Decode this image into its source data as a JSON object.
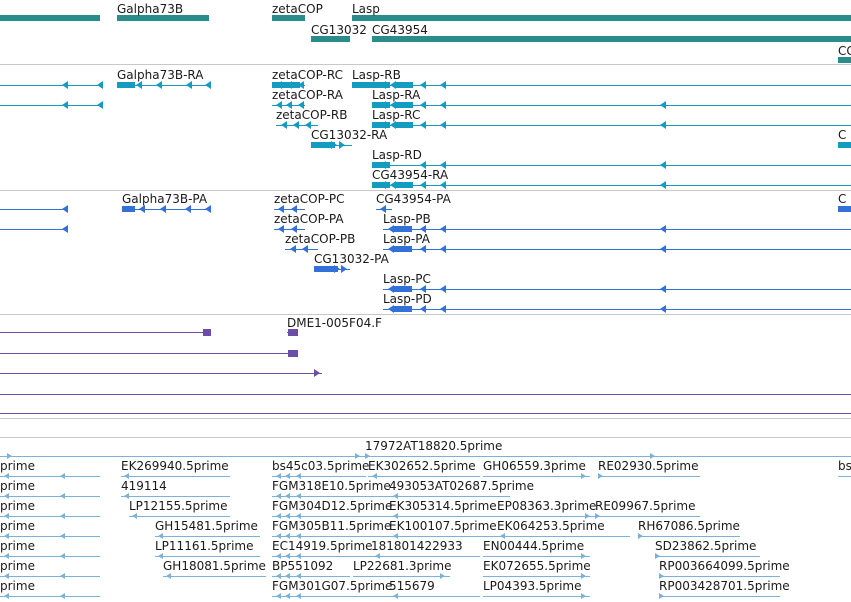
{
  "colors": {
    "gene": "#2b8c8c",
    "transcript": "#139bc0",
    "protein": "#3370d8",
    "clone": "#6c4da8",
    "est": "#7bb2d9",
    "divider": "#c8c8c8",
    "text": "#1a1a1a"
  },
  "tracks": [
    {
      "name": "gene-track",
      "color": "gene",
      "features": [
        {
          "name": "",
          "strand": "+",
          "boxes": [
            [
              0,
              100
            ]
          ]
        },
        {
          "name": "Galpha73B",
          "label": "Galpha73B",
          "strand": "-",
          "boxes": [
            [
              117,
              209
            ]
          ]
        },
        {
          "name": "zetaCOP",
          "label": "zetaCOP",
          "strand": "-",
          "boxes": [
            [
              272,
              305
            ]
          ]
        },
        {
          "name": "Lasp",
          "label": "Lasp",
          "strand": "+",
          "boxes": [
            [
              352,
              851
            ]
          ]
        },
        {
          "name": "CG13032",
          "label": "CG13032",
          "strand": "+",
          "boxes": [
            [
              311,
              350
            ]
          ]
        },
        {
          "name": "CG43954",
          "label": "CG43954",
          "strand": "+",
          "boxes": [
            [
              372,
              851
            ]
          ]
        },
        {
          "name": "CG-edge",
          "label": "CG",
          "strand": "+",
          "boxes": [
            [
              838,
              851
            ]
          ]
        }
      ]
    },
    {
      "name": "transcript-track",
      "color": "transcript",
      "features": [
        {
          "name": "",
          "strand": "-",
          "boxes": []
        },
        {
          "name": "",
          "strand": "-",
          "boxes": []
        },
        {
          "name": "Galpha73B-RA",
          "label": "Galpha73B-RA",
          "strand": "-",
          "boxes": [
            [
              117,
              135
            ]
          ]
        },
        {
          "name": "zetaCOP-RC",
          "label": "zetaCOP-RC",
          "strand": "-",
          "boxes": [
            [
              272,
              300
            ]
          ]
        },
        {
          "name": "Lasp-RB",
          "label": "Lasp-RB",
          "strand": "-",
          "boxes": [
            [
              352,
              390
            ],
            [
              395,
              413
            ]
          ]
        },
        {
          "name": "zetaCOP-RA",
          "label": "zetaCOP-RA",
          "strand": "-",
          "boxes": []
        },
        {
          "name": "Lasp-RA",
          "label": "Lasp-RA",
          "strand": "-",
          "boxes": [
            [
              372,
              390
            ],
            [
              395,
              413
            ]
          ]
        },
        {
          "name": "zetaCOP-RB",
          "label": "zetaCOP-RB",
          "strand": "-",
          "boxes": []
        },
        {
          "name": "Lasp-RC",
          "label": "Lasp-RC",
          "strand": "-",
          "boxes": [
            [
              372,
              390
            ],
            [
              395,
              413
            ]
          ]
        },
        {
          "name": "CG13032-RA",
          "label": "CG13032-RA",
          "strand": "+",
          "boxes": [
            [
              311,
              335
            ]
          ]
        },
        {
          "name": "CG-RA-edge",
          "label": "C",
          "strand": "+",
          "boxes": [
            [
              838,
              851
            ]
          ]
        },
        {
          "name": "Lasp-RD",
          "label": "Lasp-RD",
          "strand": "-",
          "boxes": [
            [
              372,
              390
            ]
          ]
        },
        {
          "name": "CG43954-RA",
          "label": "CG43954-RA",
          "strand": "-",
          "boxes": [
            [
              372,
              390
            ],
            [
              395,
              413
            ]
          ]
        }
      ]
    },
    {
      "name": "protein-track",
      "color": "protein",
      "features": [
        {
          "name": "",
          "strand": "-",
          "boxes": []
        },
        {
          "name": "",
          "strand": "-",
          "boxes": []
        },
        {
          "name": "Galpha73B-PA",
          "label": "Galpha73B-PA",
          "strand": "-",
          "boxes": [
            [
              122,
              135
            ]
          ]
        },
        {
          "name": "zetaCOP-PC",
          "label": "zetaCOP-PC",
          "strand": "-",
          "boxes": []
        },
        {
          "name": "CG43954-PA",
          "label": "CG43954-PA",
          "strand": "-",
          "boxes": []
        },
        {
          "name": "CG-PA-edge",
          "label": "C",
          "strand": "+",
          "boxes": [
            [
              838,
              851
            ]
          ]
        },
        {
          "name": "zetaCOP-PA",
          "label": "zetaCOP-PA",
          "strand": "-",
          "boxes": []
        },
        {
          "name": "Lasp-PB",
          "label": "Lasp-PB",
          "strand": "-",
          "boxes": [
            [
              393,
              412
            ]
          ]
        },
        {
          "name": "zetaCOP-PB",
          "label": "zetaCOP-PB",
          "strand": "-",
          "boxes": []
        },
        {
          "name": "Lasp-PA",
          "label": "Lasp-PA",
          "strand": "-",
          "boxes": [
            [
              393,
              412
            ]
          ]
        },
        {
          "name": "CG13032-PA",
          "label": "CG13032-PA",
          "strand": "+",
          "boxes": [
            [
              314,
              338
            ]
          ]
        },
        {
          "name": "Lasp-PC",
          "label": "Lasp-PC",
          "strand": "-",
          "boxes": [
            [
              393,
              412
            ]
          ]
        },
        {
          "name": "Lasp-PD",
          "label": "Lasp-PD",
          "strand": "-",
          "boxes": [
            [
              393,
              412
            ]
          ]
        }
      ]
    },
    {
      "name": "clone-track",
      "color": "clone",
      "features": [
        {
          "name": "",
          "strand": "+",
          "boxes": [
            [
              203,
              211
            ]
          ]
        },
        {
          "name": "DME1-005F04.F",
          "label": "DME1-005F04.F",
          "strand": "+",
          "boxes": [
            [
              288,
              298
            ]
          ]
        },
        {
          "name": "",
          "strand": "+",
          "boxes": [
            [
              288,
              298
            ]
          ]
        },
        {
          "name": "",
          "strand": "+",
          "boxes": []
        },
        {
          "name": "",
          "strand": "+",
          "boxes": []
        },
        {
          "name": "",
          "strand": "+",
          "boxes": []
        }
      ]
    },
    {
      "name": "est-track",
      "color": "est",
      "features": [
        {
          "name": "17972AT18820.5prime",
          "label": "17972AT18820.5prime",
          "strand": "+"
        },
        {
          "name": "prime-a",
          "label": "prime",
          "strand": "-"
        },
        {
          "name": "EK269940.5prime",
          "label": "EK269940.5prime",
          "strand": "-"
        },
        {
          "name": "bs45c03.5prime",
          "label": "bs45c03.5prime",
          "strand": "-"
        },
        {
          "name": "EK302652.5prime",
          "label": "EK302652.5prime",
          "strand": "-"
        },
        {
          "name": "GH06559.3prime",
          "label": "GH06559.3prime",
          "strand": "+"
        },
        {
          "name": "RE02930.5prime",
          "label": "RE02930.5prime",
          "strand": "+"
        },
        {
          "name": "bs-edge",
          "label": "bs",
          "strand": "+"
        },
        {
          "name": "prime-b",
          "label": "prime",
          "strand": "-"
        },
        {
          "name": "419114",
          "label": "419114",
          "strand": "-"
        },
        {
          "name": "FGM318E10.5prime",
          "label": "FGM318E10.5prime",
          "strand": "-"
        },
        {
          "name": "493053AT02687.5prime",
          "label": "493053AT02687.5prime",
          "strand": "-"
        },
        {
          "name": "prime-c",
          "label": "prime",
          "strand": "-"
        },
        {
          "name": "LP12155.5prime",
          "label": "LP12155.5prime",
          "strand": "-"
        },
        {
          "name": "FGM304D12.5prime",
          "label": "FGM304D12.5prime",
          "strand": "-"
        },
        {
          "name": "EK305314.5prime",
          "label": "EK305314.5prime",
          "strand": "-"
        },
        {
          "name": "EP08363.3prime",
          "label": "EP08363.3prime",
          "strand": "+"
        },
        {
          "name": "RE09967.5prime",
          "label": "RE09967.5prime",
          "strand": "+"
        },
        {
          "name": "prime-d",
          "label": "prime",
          "strand": "-"
        },
        {
          "name": "GH15481.5prime",
          "label": "GH15481.5prime",
          "strand": "-"
        },
        {
          "name": "FGM305B11.5prime",
          "label": "FGM305B11.5prime",
          "strand": "-"
        },
        {
          "name": "EK100107.5prime",
          "label": "EK100107.5prime",
          "strand": "-"
        },
        {
          "name": "EK064253.5prime",
          "label": "EK064253.5prime",
          "strand": "-"
        },
        {
          "name": "RH67086.5prime",
          "label": "RH67086.5prime",
          "strand": "+"
        },
        {
          "name": "prime-e",
          "label": "prime",
          "strand": "-"
        },
        {
          "name": "LP11161.5prime",
          "label": "LP11161.5prime",
          "strand": "-"
        },
        {
          "name": "EC14919.5prime",
          "label": "EC14919.5prime",
          "strand": "-"
        },
        {
          "name": "181801422933",
          "label": "181801422933",
          "strand": "-"
        },
        {
          "name": "EN00444.5prime",
          "label": "EN00444.5prime",
          "strand": "+"
        },
        {
          "name": "SD23862.5prime",
          "label": "SD23862.5prime",
          "strand": "+"
        },
        {
          "name": "prime-f",
          "label": "prime",
          "strand": "-"
        },
        {
          "name": "GH18081.5prime",
          "label": "GH18081.5prime",
          "strand": "-"
        },
        {
          "name": "BP551092",
          "label": "BP551092",
          "strand": "-"
        },
        {
          "name": "LP22681.3prime",
          "label": "LP22681.3prime",
          "strand": "+"
        },
        {
          "name": "EK072655.5prime",
          "label": "EK072655.5prime",
          "strand": "+"
        },
        {
          "name": "RP003664099.5prime",
          "label": "RP003664099.5prime",
          "strand": "+"
        },
        {
          "name": "prime-g",
          "label": "prime",
          "strand": "-"
        },
        {
          "name": "FGM301G07.5prime",
          "label": "FGM301G07.5prime",
          "strand": "-"
        },
        {
          "name": "515679",
          "label": "515679",
          "strand": "-"
        },
        {
          "name": "LP04393.5prime",
          "label": "LP04393.5prime",
          "strand": "+"
        },
        {
          "name": "RP003428701.5prime",
          "label": "RP003428701.5prime",
          "strand": "+"
        }
      ]
    }
  ]
}
